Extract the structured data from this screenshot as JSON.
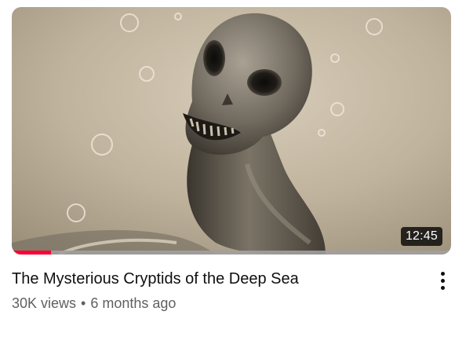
{
  "video": {
    "title": "The Mysterious Cryptids of the Deep Sea",
    "views": "30K views",
    "separator": "•",
    "age": "6 months ago",
    "duration": "12:45",
    "watch_progress": 0.09,
    "thumbnail_subject": "sepia sketch of a skull-faced long-necked sea creature with bubbles"
  },
  "menu": {
    "icon": "more-vert-icon"
  },
  "colors": {
    "progress": "#ff0033",
    "title": "#0f0f0f",
    "meta": "#606060"
  }
}
